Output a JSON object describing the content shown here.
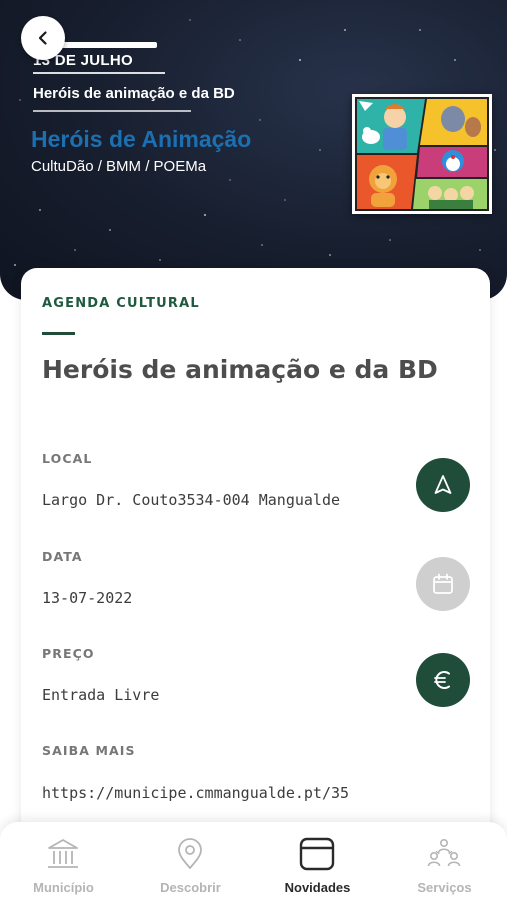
{
  "header": {
    "date": "13 DE JULHO",
    "subtitle": "Heróis de animação e da BD",
    "event_name": "Heróis de Animação",
    "organizer": "CultuDão / BMM / POEMa"
  },
  "card": {
    "category": "AGENDA CULTURAL",
    "title": "Heróis de animação e da BD",
    "fields": {
      "local": {
        "label": "LOCAL",
        "value": "Largo Dr. Couto3534-004 Mangualde"
      },
      "data": {
        "label": "DATA",
        "value": "13-07-2022"
      },
      "preco": {
        "label": "PREÇO",
        "value": "Entrada Livre"
      },
      "saiba_mais": {
        "label": "SAIBA MAIS",
        "value": "https://municipe.cmmangualde.pt/35"
      }
    }
  },
  "actions": {
    "navigate_icon": "navigation-arrow-icon",
    "calendar_icon": "calendar-icon",
    "price_icon": "euro-icon"
  },
  "nav": [
    {
      "label": "Município",
      "icon": "building-columns-icon",
      "active": false
    },
    {
      "label": "Descobrir",
      "icon": "map-pin-icon",
      "active": false
    },
    {
      "label": "Novidades",
      "icon": "news-card-icon",
      "active": true
    },
    {
      "label": "Serviços",
      "icon": "people-services-icon",
      "active": false
    }
  ],
  "colors": {
    "brand_green": "#1f4d3a",
    "accent_blue": "#1c6fb0",
    "nav_inactive": "#b5b5b5",
    "nav_active": "#2a2a2a"
  }
}
